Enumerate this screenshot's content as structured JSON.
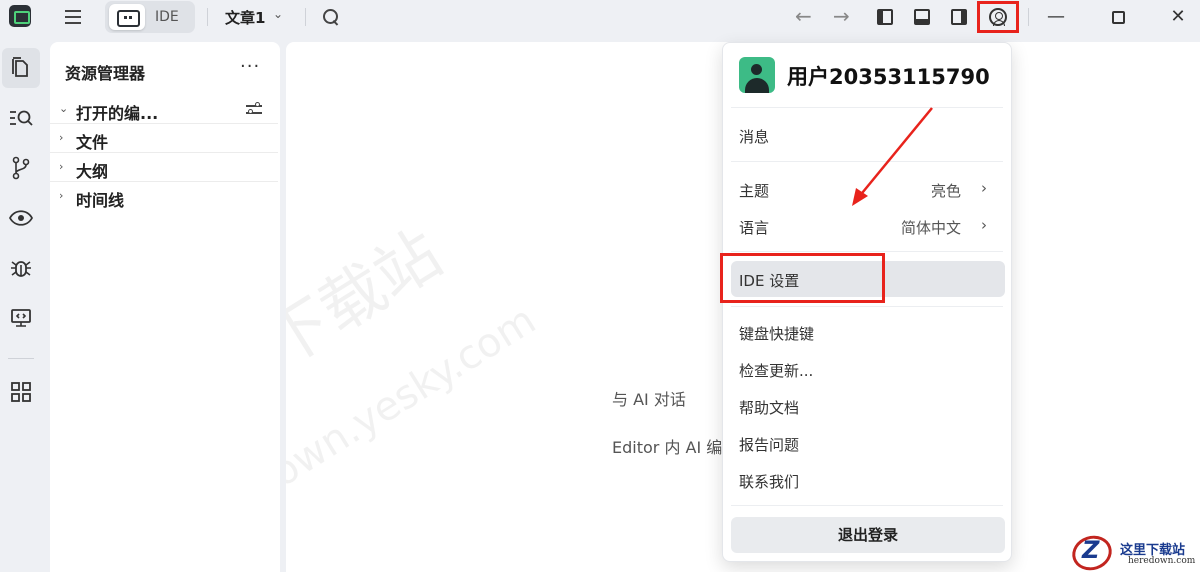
{
  "titlebar": {
    "mode_label": "IDE",
    "doc_title": "文章1",
    "doc_chevron": "⌄",
    "back_arrow": "←",
    "forward_arrow": "→",
    "minimize": "—",
    "close": "✕"
  },
  "activity_bar": {
    "icons": [
      "explorer-icon",
      "search-list-icon",
      "source-control-icon",
      "preview-eye-icon",
      "debug-bug-icon",
      "remote-screen-icon",
      "extensions-grid-icon"
    ]
  },
  "explorer": {
    "title": "资源管理器",
    "more": "···",
    "sections": [
      {
        "label": "打开的编...",
        "chevron": "⌄"
      },
      {
        "label": "文件",
        "chevron": "›"
      },
      {
        "label": "大纲",
        "chevron": "›"
      },
      {
        "label": "时间线",
        "chevron": "›"
      }
    ]
  },
  "editor": {
    "lines": [
      "与 AI 对话",
      "Editor 内 AI 编"
    ],
    "watermark_cn": "天极下载站",
    "watermark_en": "mydown.yesky.com"
  },
  "user_menu": {
    "username": "用户20353115790",
    "items": {
      "messages": "消息",
      "theme_label": "主题",
      "theme_value": "亮色",
      "language_label": "语言",
      "language_value": "简体中文",
      "ide_settings": "IDE 设置",
      "shortcuts": "键盘快捷键",
      "check_updates": "检查更新...",
      "help_docs": "帮助文档",
      "report_issue": "报告问题",
      "contact_us": "联系我们"
    },
    "chevron": "›",
    "logout": "退出登录"
  },
  "brand": {
    "cn": "这里下载站",
    "en": "heredown.com"
  },
  "colors": {
    "highlight_red": "#e8231c",
    "avatar_green": "#3dbb86",
    "app_green": "#4ed07a"
  }
}
